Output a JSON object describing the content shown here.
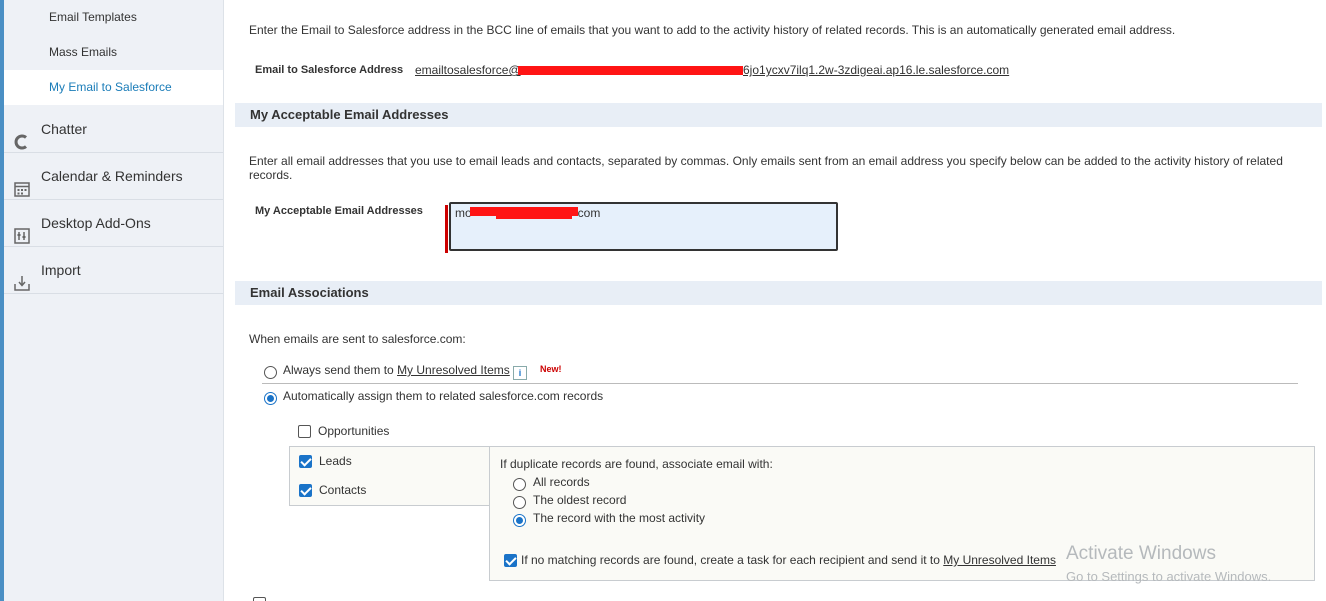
{
  "sidebar": {
    "sub_items": [
      {
        "label": "Email Templates"
      },
      {
        "label": "Mass Emails"
      },
      {
        "label": "My Email to Salesforce"
      }
    ],
    "main_items": [
      {
        "label": "Chatter",
        "icon": "chatter-icon"
      },
      {
        "label": "Calendar & Reminders",
        "icon": "calendar-icon"
      },
      {
        "label": "Desktop Add-Ons",
        "icon": "desktop-addons-icon"
      },
      {
        "label": "Import",
        "icon": "import-icon"
      }
    ]
  },
  "intro": "Enter the Email to Salesforce address in the BCC line of emails that you want to add to the activity history of related records. This is an automatically generated email address.",
  "email_address": {
    "label": "Email to Salesforce Address",
    "value_start": "emailtosalesforce@",
    "value_end": "6jo1ycxv7ilq1.2w-3zdigeai.ap16.le.salesforce.com"
  },
  "acceptable": {
    "heading": "My Acceptable Email Addresses",
    "description": "Enter all email addresses that you use to email leads and contacts, separated by commas. Only emails sent from an email address you specify below can be added to the activity history of related records.",
    "field_label": "My Acceptable Email Addresses",
    "value_start": "mo",
    "value_end": "com"
  },
  "associations": {
    "heading": "Email Associations",
    "when_text": "When emails are sent to salesforce.com:",
    "option_always_prefix": "Always send them to ",
    "option_always_link": "My Unresolved Items",
    "new_badge": "New!",
    "option_auto": "Automatically assign them to related salesforce.com records",
    "opportunities": "Opportunities",
    "leads": "Leads",
    "contacts": "Contacts",
    "dup_heading": "If duplicate records are found, associate email with:",
    "dup_options": [
      "All records",
      "The oldest record",
      "The record with the most activity"
    ],
    "no_match_prefix": "If no matching records are found, create a task for each recipient and send it to ",
    "no_match_link": "My Unresolved Items"
  },
  "watermark": {
    "line1": "Activate Windows",
    "line2": "Go to Settings to activate Windows."
  },
  "colors": {
    "accent": "#1a73c8",
    "section_bg": "#e8eef6",
    "sidebar_bg": "#eef1f6",
    "required": "#cc0000"
  }
}
